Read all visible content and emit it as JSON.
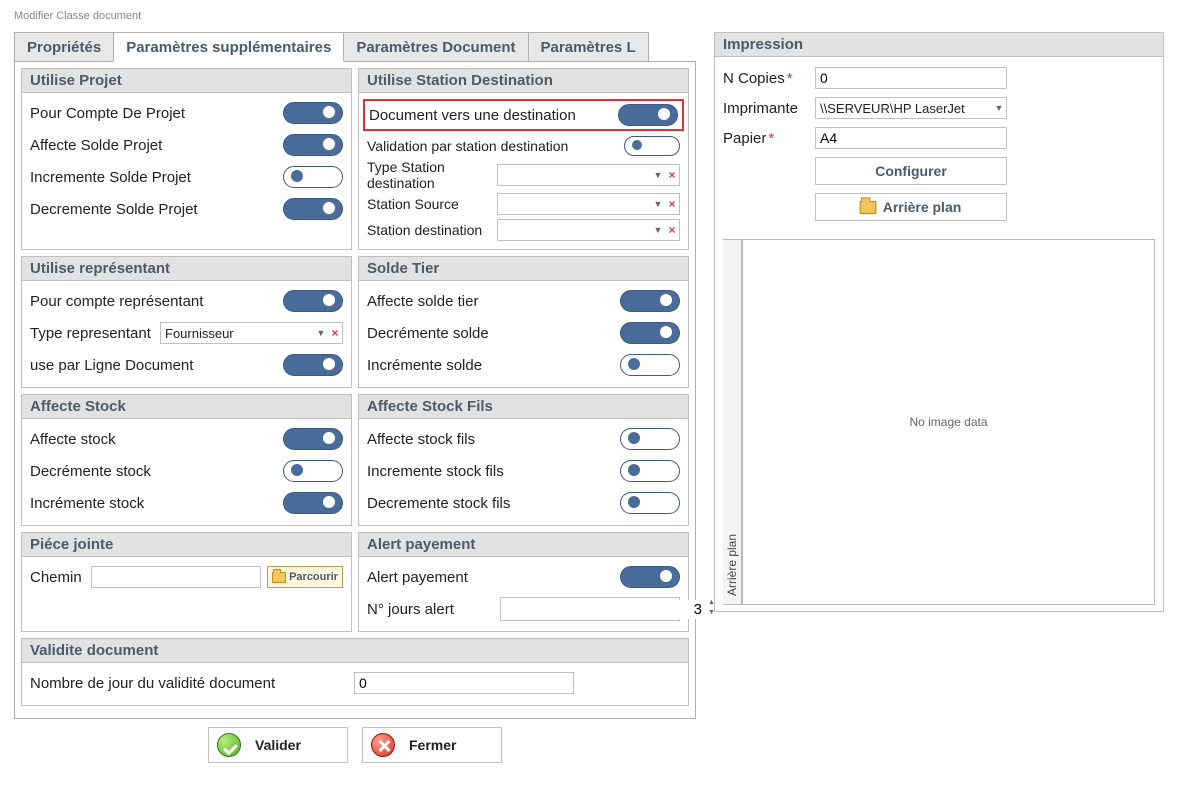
{
  "window_title": "Modifier Classe document",
  "tabs": {
    "proprietes": "Propriétés",
    "params_sup": "Paramètres supplémentaires",
    "params_doc": "Paramètres Document",
    "params_l": "Paramètres L"
  },
  "grp_projet": {
    "title": "Utilise Projet",
    "pour_compte": "Pour Compte De Projet",
    "affecte": "Affecte Solde Projet",
    "incr": "Incremente Solde Projet",
    "decr": "Decremente Solde Projet"
  },
  "grp_station": {
    "title": "Utilise Station Destination",
    "doc_dest": "Document vers une destination",
    "valid_dest": "Validation par station destination",
    "type_station": "Type Station destination",
    "station_src": "Station Source",
    "station_dst": "Station destination"
  },
  "grp_rep": {
    "title": "Utilise représentant",
    "pour_compte": "Pour compte représentant",
    "type": "Type representant",
    "type_val": "Fournisseur",
    "use_ligne": "use par Ligne Document"
  },
  "grp_solde": {
    "title": "Solde Tier",
    "affecte": "Affecte solde tier",
    "decr": "Decrémente solde",
    "incr": "Incrémente solde"
  },
  "grp_stock": {
    "title": "Affecte Stock",
    "affecte": "Affecte stock",
    "decr": "Decrémente stock",
    "incr": "Incrémente stock"
  },
  "grp_stockfils": {
    "title": "Affecte Stock Fils",
    "affecte": "Affecte stock fils",
    "incr": "Incremente stock fils",
    "decr": "Decremente stock fils"
  },
  "grp_piece": {
    "title": "Piéce jointe",
    "chemin": "Chemin",
    "parcourir": "Parcourir"
  },
  "grp_alert": {
    "title": "Alert payement",
    "alert": "Alert payement",
    "nj": "N° jours alert",
    "nj_val": "3"
  },
  "grp_valid": {
    "title": "Validite document",
    "nj": "Nombre de jour du validité document",
    "nj_val": "0"
  },
  "impression": {
    "title": "Impression",
    "ncopies": "N Copies",
    "ncopies_val": "0",
    "imprimante": "Imprimante",
    "imprimante_val": "\\\\SERVEUR\\HP LaserJet",
    "papier": "Papier",
    "papier_val": "A4",
    "configurer": "Configurer",
    "arriere": "Arrière plan",
    "sidetab": "Arrière plan",
    "noimg": "No image data"
  },
  "buttons": {
    "valider": "Valider",
    "fermer": "Fermer"
  }
}
